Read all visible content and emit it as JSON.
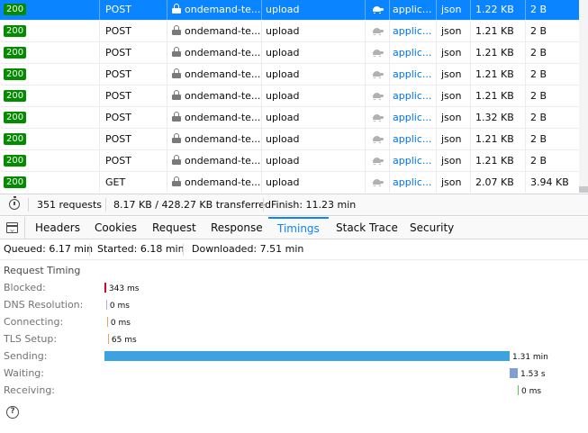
{
  "requests": [
    {
      "status": "200",
      "method": "POST",
      "domain": "ondemand-te...",
      "file": "upload",
      "type": "applic...",
      "format": "json",
      "transferred": "1.22 KB",
      "size": "2 B",
      "selected": true
    },
    {
      "status": "200",
      "method": "POST",
      "domain": "ondemand-te...",
      "file": "upload",
      "type": "applic...",
      "format": "json",
      "transferred": "1.21 KB",
      "size": "2 B"
    },
    {
      "status": "200",
      "method": "POST",
      "domain": "ondemand-te...",
      "file": "upload",
      "type": "applic...",
      "format": "json",
      "transferred": "1.21 KB",
      "size": "2 B"
    },
    {
      "status": "200",
      "method": "POST",
      "domain": "ondemand-te...",
      "file": "upload",
      "type": "applic...",
      "format": "json",
      "transferred": "1.21 KB",
      "size": "2 B"
    },
    {
      "status": "200",
      "method": "POST",
      "domain": "ondemand-te...",
      "file": "upload",
      "type": "applic...",
      "format": "json",
      "transferred": "1.21 KB",
      "size": "2 B"
    },
    {
      "status": "200",
      "method": "POST",
      "domain": "ondemand-te...",
      "file": "upload",
      "type": "applic...",
      "format": "json",
      "transferred": "1.32 KB",
      "size": "2 B"
    },
    {
      "status": "200",
      "method": "POST",
      "domain": "ondemand-te...",
      "file": "upload",
      "type": "applic...",
      "format": "json",
      "transferred": "1.21 KB",
      "size": "2 B"
    },
    {
      "status": "200",
      "method": "POST",
      "domain": "ondemand-te...",
      "file": "upload",
      "type": "applic...",
      "format": "json",
      "transferred": "1.21 KB",
      "size": "2 B"
    },
    {
      "status": "200",
      "method": "GET",
      "domain": "ondemand-te...",
      "file": "upload",
      "type": "applic...",
      "format": "json",
      "transferred": "2.07 KB",
      "size": "3.94 KB"
    }
  ],
  "summary": {
    "requests": "351 requests",
    "transferred": "8.17 KB / 428.27 KB transferred",
    "finish": "Finish: 11.23 min"
  },
  "tabs": [
    "Headers",
    "Cookies",
    "Request",
    "Response",
    "Timings",
    "Stack Trace",
    "Security"
  ],
  "selected_tab": "Timings",
  "timings_summary": {
    "queued": "Queued: 6.17 min",
    "started": "Started: 6.18 min",
    "downloaded": "Downloaded: 7.51 min"
  },
  "request_timing_heading": "Request Timing",
  "timings": [
    {
      "label": "Blocked:",
      "value": "343 ms",
      "color": "#ce0a2a"
    },
    {
      "label": "DNS Resolution:",
      "value": "0 ms",
      "color": "#c0a7d6"
    },
    {
      "label": "Connecting:",
      "value": "0 ms",
      "color": "#e5a35d"
    },
    {
      "label": "TLS Setup:",
      "value": "65 ms",
      "color": "#e5a35d"
    },
    {
      "label": "Sending:",
      "value": "1.31 min",
      "color": "#3da3e0"
    },
    {
      "label": "Waiting:",
      "value": "1.53 s",
      "color": "#7e9fd1"
    },
    {
      "label": "Receiving:",
      "value": "0 ms",
      "color": "#5fc448"
    }
  ],
  "colors": {
    "accent": "#0a84ff",
    "status_ok": "#058b00",
    "link": "#0074e8"
  },
  "icons": {
    "secure": "lock-icon",
    "slow": "turtle-icon",
    "summary": "stopwatch-icon",
    "panel_toggle": "panel-toggle-icon",
    "help": "help-icon"
  }
}
